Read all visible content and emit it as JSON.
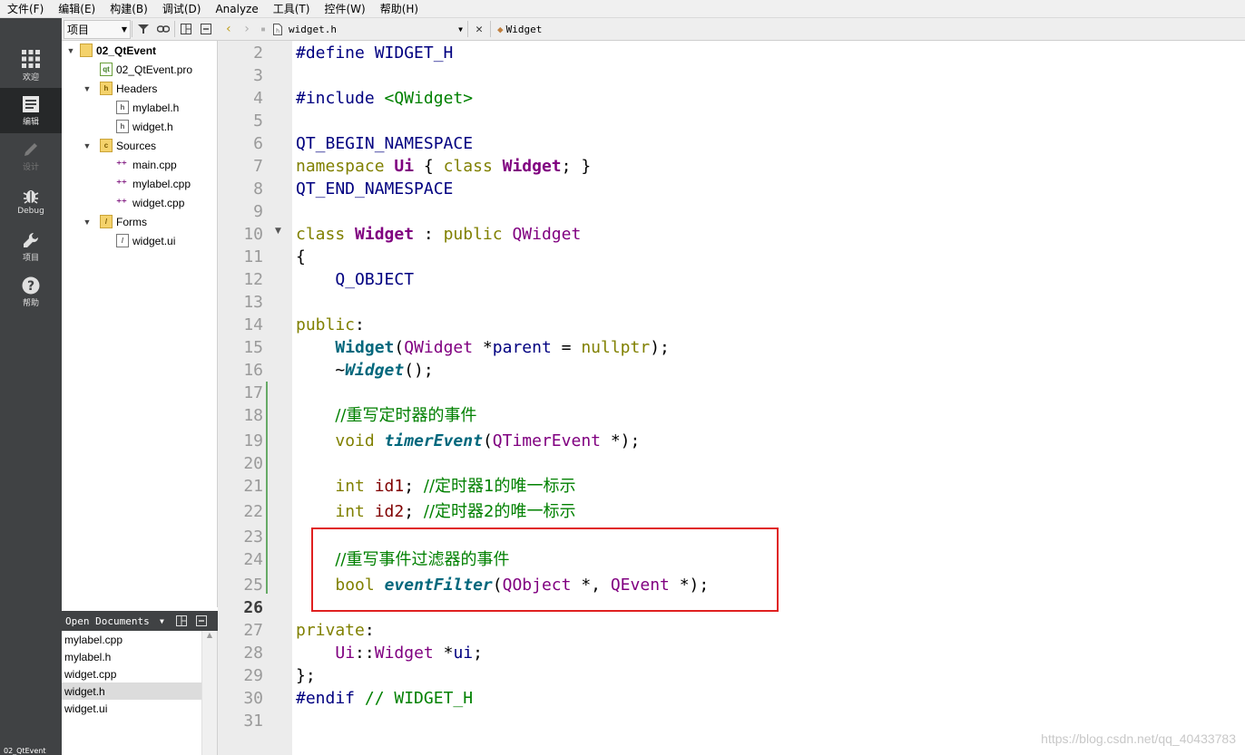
{
  "menubar": [
    "文件(F)",
    "编辑(E)",
    "构建(B)",
    "调试(D)",
    "Analyze",
    "工具(T)",
    "控件(W)",
    "帮助(H)"
  ],
  "modes": [
    {
      "label": "欢迎",
      "icon": "grid-icon"
    },
    {
      "label": "编辑",
      "icon": "edit-document-icon"
    },
    {
      "label": "设计",
      "icon": "pencil-icon"
    },
    {
      "label": "Debug",
      "icon": "bug-icon"
    },
    {
      "label": "项目",
      "icon": "wrench-icon"
    },
    {
      "label": "帮助",
      "icon": "help-icon"
    }
  ],
  "project_status": "02_QtEvent",
  "project_panel": {
    "view_selector": "项目",
    "tree": [
      {
        "label": "02_QtEvent",
        "type": "project"
      },
      {
        "label": "02_QtEvent.pro",
        "type": "pro"
      },
      {
        "label": "Headers",
        "type": "folder"
      },
      {
        "label": "mylabel.h",
        "type": "file"
      },
      {
        "label": "widget.h",
        "type": "file",
        "selected": true
      },
      {
        "label": "Sources",
        "type": "folder"
      },
      {
        "label": "main.cpp",
        "type": "cpp"
      },
      {
        "label": "mylabel.cpp",
        "type": "cpp"
      },
      {
        "label": "widget.cpp",
        "type": "cpp"
      },
      {
        "label": "Forms",
        "type": "folder"
      },
      {
        "label": "widget.ui",
        "type": "ui"
      }
    ]
  },
  "open_documents": {
    "title": "Open Documents",
    "items": [
      "mylabel.cpp",
      "mylabel.h",
      "widget.cpp",
      "widget.h",
      "widget.ui"
    ],
    "selected": "widget.h"
  },
  "editor": {
    "document": "widget.h",
    "symbol": "Widget",
    "current_line": "26",
    "line_numbers": [
      "2",
      "3",
      "4",
      "5",
      "6",
      "7",
      "8",
      "9",
      "10",
      "11",
      "12",
      "13",
      "14",
      "15",
      "16",
      "17",
      "18",
      "19",
      "20",
      "21",
      "22",
      "23",
      "24",
      "25",
      "26",
      "27",
      "28",
      "29",
      "30",
      "31"
    ],
    "code": {
      "l2": [
        "#define WIDGET_H"
      ],
      "l4": [
        "#include ",
        "<QWidget>"
      ],
      "l6": [
        "QT_BEGIN_NAMESPACE"
      ],
      "l7": [
        "namespace",
        " ",
        "Ui",
        " { ",
        "class",
        " ",
        "Widget",
        "; }"
      ],
      "l8": [
        "QT_END_NAMESPACE"
      ],
      "l10": [
        "class",
        " ",
        "Widget",
        " : ",
        "public",
        " ",
        "QWidget"
      ],
      "l11": [
        "{"
      ],
      "l12": [
        "    ",
        "Q_OBJECT"
      ],
      "l14": [
        "public",
        ":"
      ],
      "l15": [
        "    ",
        "Widget",
        "(",
        "QWidget",
        " *",
        "parent",
        " = ",
        "nullptr",
        ");"
      ],
      "l16": [
        "    ~",
        "Widget",
        "();"
      ],
      "l18": [
        "    ",
        "//重写定时器的事件"
      ],
      "l19": [
        "    ",
        "void",
        " ",
        "timerEvent",
        "(",
        "QTimerEvent",
        " *);"
      ],
      "l21": [
        "    ",
        "int",
        " ",
        "id1",
        "; ",
        "//定时器1的唯一标示"
      ],
      "l22": [
        "    ",
        "int",
        " ",
        "id2",
        "; ",
        "//定时器2的唯一标示"
      ],
      "l24": [
        "    ",
        "//重写事件过滤器的事件"
      ],
      "l25": [
        "    ",
        "bool",
        " ",
        "eventFilter",
        "(",
        "QObject",
        " *, ",
        "QEvent",
        " *);"
      ],
      "l27": [
        "private",
        ":"
      ],
      "l28": [
        "    ",
        "Ui",
        "::",
        "Widget",
        " *",
        "ui",
        ";"
      ],
      "l29": [
        "};"
      ],
      "l30": [
        "#endif",
        " ",
        "// WIDGET_H"
      ]
    }
  },
  "watermark": "https://blog.csdn.net/qq_40433783",
  "colors": {
    "highlight_box": "#e02020",
    "keyword": "#808000",
    "type": "#800080",
    "function": "#00677c",
    "comment": "#008000",
    "sidebar": "#404244"
  }
}
